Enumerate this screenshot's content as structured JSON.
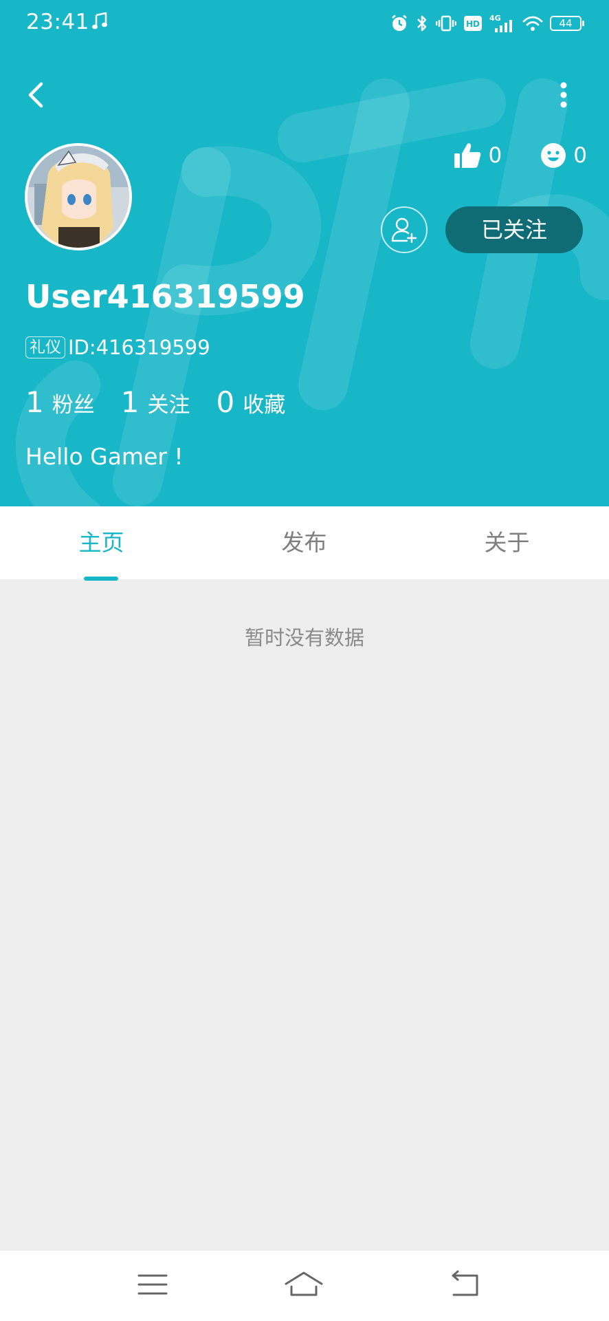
{
  "status_bar": {
    "time": "23:41",
    "network": "4G",
    "battery": "44",
    "icons": [
      "music-note-icon",
      "alarm-icon",
      "bluetooth-icon",
      "vibrate-icon",
      "hd-icon",
      "signal-icon",
      "wifi-icon",
      "battery-icon"
    ]
  },
  "header": {
    "background_color": "#17b7c8",
    "likes_count": "0",
    "reactions_count": "0",
    "follow_button_label": "已关注",
    "username": "User416319599",
    "id_tag": "礼仪",
    "id_text": "ID:416319599",
    "bio": "Hello Gamer !",
    "counts": [
      {
        "number": "1",
        "label": "粉丝"
      },
      {
        "number": "1",
        "label": "关注"
      },
      {
        "number": "0",
        "label": "收藏"
      }
    ]
  },
  "tabs": [
    {
      "label": "主页",
      "active": true
    },
    {
      "label": "发布",
      "active": false
    },
    {
      "label": "关于",
      "active": false
    }
  ],
  "content": {
    "empty_text": "暂时没有数据"
  },
  "colors": {
    "accent": "#17b7c8",
    "follow_button_bg": "#0f6b74",
    "content_bg": "#eeeeee"
  }
}
